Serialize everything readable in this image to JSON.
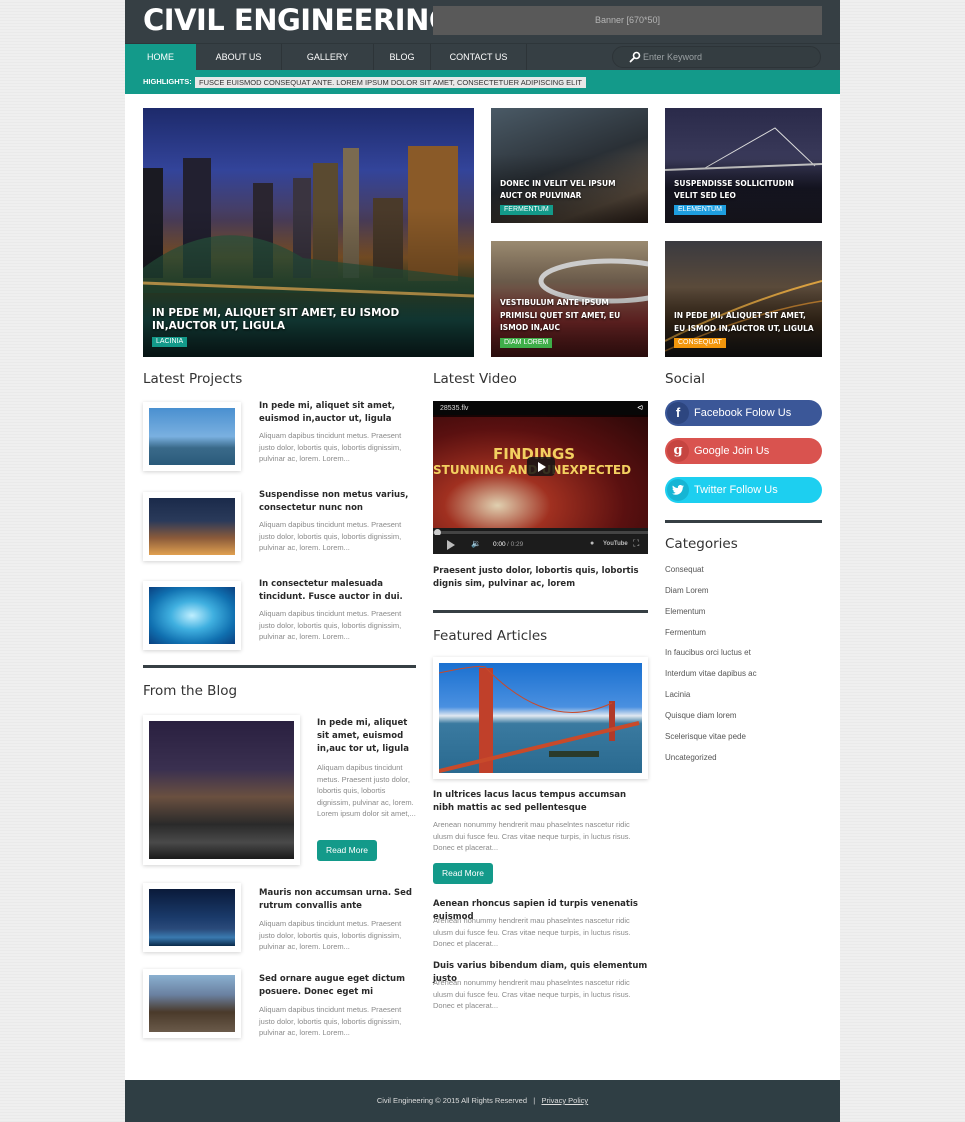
{
  "header": {
    "logo": "CIVIL ENGINEERING",
    "banner": "Banner [670*50]"
  },
  "nav": {
    "items": [
      {
        "label": "HOME",
        "active": true
      },
      {
        "label": "ABOUT US"
      },
      {
        "label": "GALLERY"
      },
      {
        "label": "BLOG"
      },
      {
        "label": "CONTACT US"
      }
    ],
    "search_placeholder": "Enter Keyword"
  },
  "highlights": {
    "label": "HIGHLIGHTS:",
    "text": "FUSCE EUISMOD CONSEQUAT ANTE. LOREM IPSUM DOLOR SIT AMET, CONSECTETUER ADIPISCING ELIT"
  },
  "featured_tiles": [
    {
      "title": "IN PEDE MI, ALIQUET SIT AMET, EU ISMOD IN,AUCTOR UT, LIGULA",
      "tag": "LACINIA",
      "tag_color": "#139a8a"
    },
    {
      "title": "DONEC IN VELIT VEL IPSUM AUCT OR PULVINAR",
      "tag": "FERMENTUM",
      "tag_color": "#139a8a"
    },
    {
      "title": "SUSPENDISSE SOLLICITUDIN VELIT SED LEO",
      "tag": "ELEMENTUM",
      "tag_color": "#1e9ee0"
    },
    {
      "title": "VESTIBULUM ANTE IPSUM PRIMISLI QUET SIT AMET, EU ISMOD IN,AUC",
      "tag": "DIAM LOREM",
      "tag_color": "#3fae49"
    },
    {
      "title": "IN PEDE MI, ALIQUET SIT AMET, EU ISMOD IN,AUCTOR UT, LIGULA",
      "tag": "CONSEQUAT",
      "tag_color": "#f2960c"
    }
  ],
  "latest_projects": {
    "title": "Latest Projects",
    "items": [
      {
        "title": "In pede mi, aliquet sit amet, euismod in,auctor ut, ligula",
        "text": "Aliquam dapibus tincidunt metus. Praesent justo dolor, lobortis quis, lobortis dignissim, pulvinar ac, lorem. Lorem..."
      },
      {
        "title": "Suspendisse non metus varius, consectetur nunc non",
        "text": "Aliquam dapibus tincidunt metus. Praesent justo dolor, lobortis quis, lobortis dignissim, pulvinar ac, lorem. Lorem..."
      },
      {
        "title": "In consectetur malesuada tincidunt. Fusce auctor in dui.",
        "text": "Aliquam dapibus tincidunt metus. Praesent justo dolor, lobortis quis, lobortis dignissim, pulvinar ac, lorem. Lorem..."
      }
    ]
  },
  "latest_video": {
    "title": "Latest Video",
    "filename": "28535.flv",
    "video_headline_1": "FINDINGS",
    "video_headline_2": "STUNNING AND UNEXPECTED",
    "time": "0:00",
    "duration": "/ 0:29",
    "youtube": "YouTube",
    "caption": "Praesent justo dolor, lobortis quis, lobortis dignis sim, pulvinar ac, lorem"
  },
  "social": {
    "title": "Social",
    "buttons": [
      {
        "label": "Facebook Folow Us",
        "icon": "f",
        "color": "#3b5798",
        "circle": "#2d4680"
      },
      {
        "label": "Google Join Us",
        "icon": "g",
        "color": "#d9534f",
        "circle": "#c64541"
      },
      {
        "label": "Twitter Follow Us",
        "icon": "t",
        "color": "#1dcff0",
        "circle": "#16b5d4"
      }
    ]
  },
  "categories": {
    "title": "Categories",
    "items": [
      "Consequat",
      "Diam Lorem",
      "Elementum",
      "Fermentum",
      "In faucibus orci luctus et",
      "Interdum vitae dapibus ac",
      "Lacinia",
      "Quisque diam lorem",
      "Scelerisque vitae pede",
      "Uncategorized"
    ]
  },
  "blog": {
    "title": "From the Blog",
    "main": {
      "title": "In pede mi, aliquet sit amet, euismod in,auc tor ut, ligula",
      "text": "Aliquam dapibus tincidunt metus. Praesent justo dolor, lobortis quis, lobortis dignissim, pulvinar ac, lorem. Lorem ipsum dolor sit amet,...",
      "button": "Read More"
    },
    "items": [
      {
        "title": "Mauris non accumsan urna. Sed rutrum convallis ante",
        "text": "Aliquam dapibus tincidunt metus. Praesent justo dolor, lobortis quis, lobortis dignissim, pulvinar ac, lorem. Lorem..."
      },
      {
        "title": "Sed ornare augue eget dictum posuere. Donec eget mi",
        "text": "Aliquam dapibus tincidunt metus. Praesent justo dolor, lobortis quis, lobortis dignissim, pulvinar ac, lorem. Lorem..."
      }
    ]
  },
  "featured_articles": {
    "title": "Featured Articles",
    "main": {
      "title": "In ultrices lacus lacus tempus accumsan nibh mattis ac sed pellentesque",
      "text": "Arenean nonummy hendrerit mau phaselntes nascetur ridic ulusm dui fusce feu. Cras vitae neque turpis, in luctus risus. Donec et placerat...",
      "button": "Read More"
    },
    "items": [
      {
        "title": "Aenean rhoncus sapien id turpis venenatis euismod",
        "text": "Arenean nonummy hendrerit mau phaselntes nascetur ridic ulusm dui fusce feu. Cras vitae neque turpis, in luctus risus. Donec et placerat..."
      },
      {
        "title": "Duis varius bibendum diam, quis elementum justo",
        "text": "Arenean nonummy hendrerit mau phaselntes nascetur ridic ulusm dui fusce feu. Cras vitae neque turpis, in luctus risus. Donec et placerat..."
      }
    ]
  },
  "footer": {
    "copyright": "Civil Engineering © 2015 All Rights Reserved",
    "separator": "|",
    "privacy": "Privacy Policy"
  }
}
